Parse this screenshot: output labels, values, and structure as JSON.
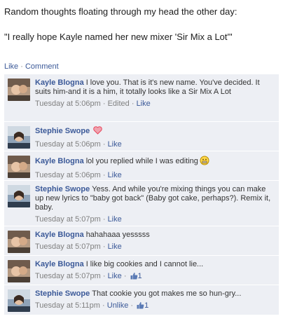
{
  "post": {
    "line1": "Random thoughts floating through my head the other day:",
    "line2": "\"I really hope Kayle named her new mixer 'Sir Mix a Lot'\""
  },
  "actions": {
    "like": "Like",
    "separator": "·",
    "comment": "Comment"
  },
  "comments": [
    {
      "author": "Kayle Blogna",
      "text": "I love you. That is it's new name. You've decided. It suits him-and it is a him, it totally looks like a Sir Mix A Lot",
      "time": "Tuesday at 5:06pm",
      "edited": "Edited",
      "like": "Like"
    },
    {
      "author": "Stephie Swope",
      "text": "",
      "emoji": "heart-icon",
      "time": "Tuesday at 5:06pm",
      "like": "Like"
    },
    {
      "author": "Kayle Blogna",
      "text": "lol you replied while I was editing",
      "emoji": "grimace-smiley-icon",
      "time": "Tuesday at 5:06pm",
      "like": "Like"
    },
    {
      "author": "Stephie Swope",
      "text": "Yess. And while you're mixing things you can make up new lyrics to \"baby got back\" (Baby got cake, perhaps?). Remix it, baby.",
      "time": "Tuesday at 5:07pm",
      "like": "Like"
    },
    {
      "author": "Kayle Blogna",
      "text": "hahahaaa yesssss",
      "time": "Tuesday at 5:07pm",
      "like": "Like"
    },
    {
      "author": "Kayle Blogna",
      "text": "I like big cookies and I cannot lie...",
      "time": "Tuesday at 5:07pm",
      "like": "Like",
      "like_count": "1"
    },
    {
      "author": "Stephie Swope",
      "text": "That cookie you got makes me so hun-gry...",
      "time": "Tuesday at 5:11pm",
      "like": "Unlike",
      "like_count": "1"
    }
  ],
  "colors": {
    "link": "#3b5998",
    "comment_bg": "#edeff4",
    "meta": "#808080",
    "heart": "#e8485e"
  }
}
